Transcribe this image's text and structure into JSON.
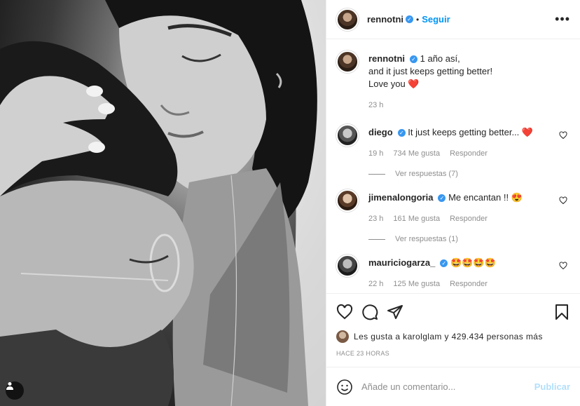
{
  "post": {
    "author": "rennotni",
    "follow_label": "Seguir",
    "more_label": "•••",
    "separator": "•"
  },
  "caption": {
    "username": "rennotni",
    "lines": [
      "1 año así,",
      "and it just keeps getting better!",
      "Love you ❤️"
    ],
    "time": "23 h"
  },
  "comments": [
    {
      "username": "diego",
      "text": "It just keeps getting better... ❤️",
      "time": "19 h",
      "likes": "734 Me gusta",
      "reply": "Responder",
      "replies": "Ver respuestas (7)"
    },
    {
      "username": "jimenalongoria",
      "text": "Me encantan !! 😍",
      "time": "23 h",
      "likes": "161 Me gusta",
      "reply": "Responder",
      "replies": "Ver respuestas (1)"
    },
    {
      "username": "mauriciogarza_",
      "text": "🤩🤩🤩🤩",
      "time": "22 h",
      "likes": "125 Me gusta",
      "reply": "Responder"
    }
  ],
  "likes_text": "Les gusta a karolglam y 429.434 personas más",
  "time_ago": "HACE 23 HORAS",
  "comment_box": {
    "placeholder": "Añade un comentario...",
    "publish_label": "Publicar"
  },
  "colors": {
    "link": "#0095f6",
    "publish_disabled": "#b2dffc",
    "verified": "#3897f0",
    "heart": "#e02020"
  },
  "icons": [
    "heart-icon",
    "comment-icon",
    "share-icon",
    "bookmark-icon",
    "emoji-icon",
    "user-tag-icon",
    "verified-badge-icon",
    "more-options-icon"
  ]
}
